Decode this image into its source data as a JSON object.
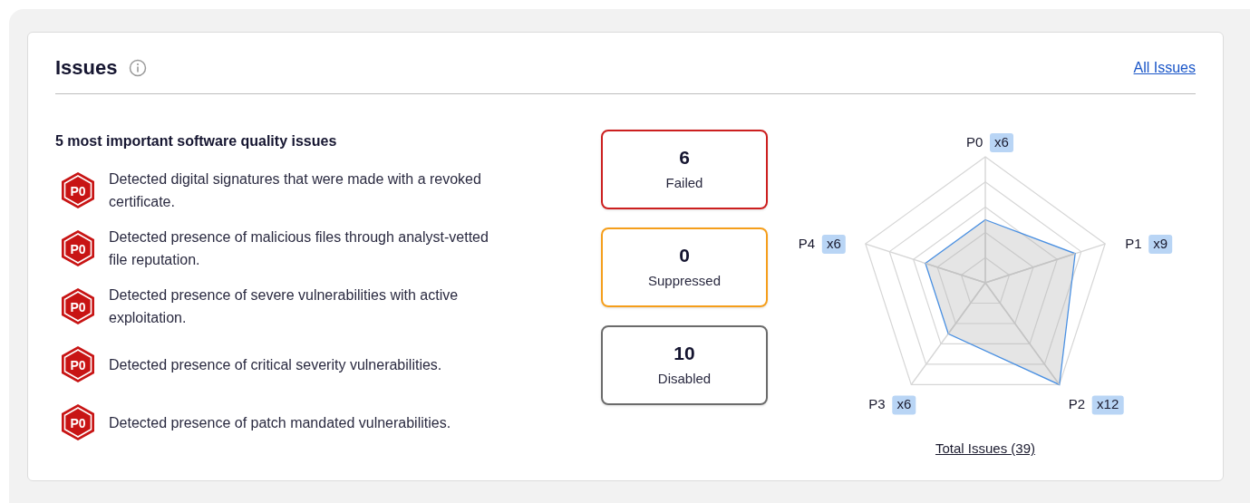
{
  "card": {
    "title": "Issues",
    "link": "All Issues"
  },
  "top_issues": {
    "heading": "5 most important software quality issues",
    "items": [
      {
        "badge": "P0",
        "text": "Detected digital signatures that were made with a revoked certificate."
      },
      {
        "badge": "P0",
        "text": "Detected presence of malicious files through analyst-vetted file reputation."
      },
      {
        "badge": "P0",
        "text": "Detected presence of severe vulnerabilities with active exploitation."
      },
      {
        "badge": "P0",
        "text": "Detected presence of critical severity vulnerabilities."
      },
      {
        "badge": "P0",
        "text": "Detected presence of patch mandated vulnerabilities."
      }
    ]
  },
  "status_cards": [
    {
      "count": "6",
      "label": "Failed",
      "color": "#cc1f1f"
    },
    {
      "count": "0",
      "label": "Suppressed",
      "color": "#f59e1b"
    },
    {
      "count": "10",
      "label": "Disabled",
      "color": "#6b6b6b"
    }
  ],
  "radar": {
    "axes": [
      {
        "label": "P0",
        "count": "x6",
        "level": 0.5
      },
      {
        "label": "P1",
        "count": "x9",
        "level": 0.75
      },
      {
        "label": "P2",
        "count": "x12",
        "level": 1
      },
      {
        "label": "P3",
        "count": "x6",
        "level": 0.5
      },
      {
        "label": "P4",
        "count": "x6",
        "level": 0.5
      }
    ],
    "total": "Total Issues (39)"
  }
}
